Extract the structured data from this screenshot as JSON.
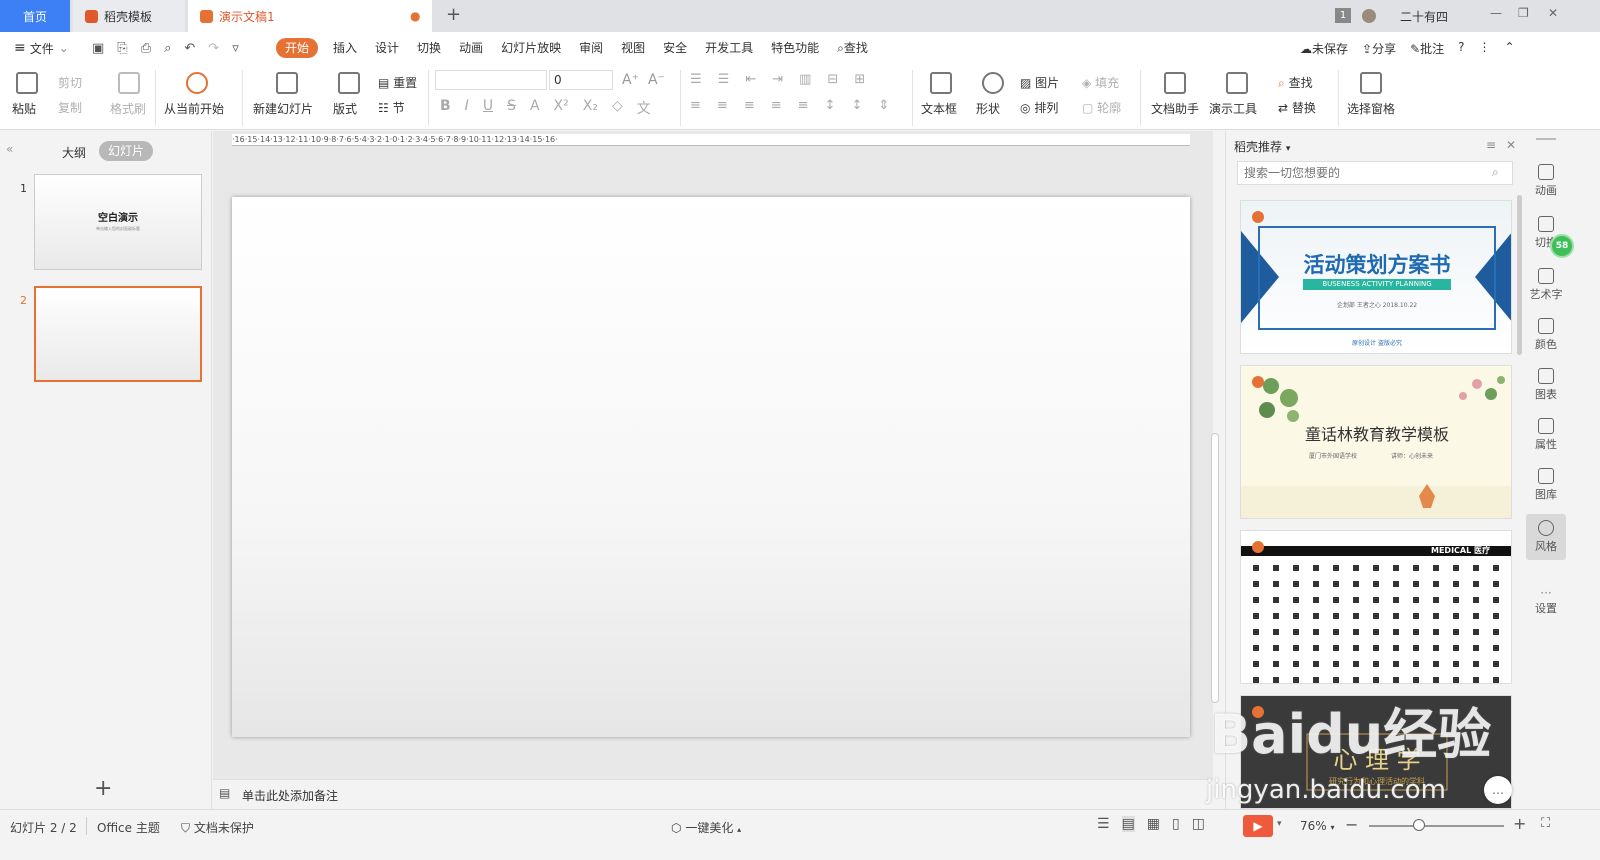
{
  "tabs": {
    "home": "首页",
    "template": "稻壳模板",
    "doc": "演示文稿1",
    "add": "+"
  },
  "titlebar": {
    "page_badge": "1",
    "user": "二十有四",
    "minimize": "—",
    "restore": "❐",
    "close": "✕"
  },
  "menubar": {
    "file": "文件",
    "items": [
      "开始",
      "插入",
      "设计",
      "切换",
      "动画",
      "幻灯片放映",
      "审阅",
      "视图",
      "安全",
      "开发工具",
      "特色功能"
    ],
    "search": "查找",
    "unsaved": "未保存",
    "share": "分享",
    "comment": "批注",
    "help": "?"
  },
  "ribbon": {
    "paste": "粘贴",
    "cut": "剪切",
    "copy": "复制",
    "format_painter": "格式刷",
    "play_from_current": "从当前开始",
    "new_slide": "新建幻灯片",
    "layout": "版式",
    "reset": "重置",
    "section": "节",
    "font_size": "0",
    "textbox": "文本框",
    "shape": "形状",
    "picture": "图片",
    "fill": "填充",
    "arrange": "排列",
    "outline": "轮廓",
    "doc_helper": "文档助手",
    "present_tool": "演示工具",
    "find": "查找",
    "replace": "替换",
    "selection_pane": "选择窗格"
  },
  "leftpane": {
    "outline_tab": "大纲",
    "slides_tab": "幻灯片",
    "slide1_num": "1",
    "slide1_title": "空白演示",
    "slide1_sub": "单击输入您的封面副标题",
    "slide2_num": "2",
    "add": "+"
  },
  "ruler": {
    "text": "·16·15·14·13·12·11·10·9·8·7·6·5·4·3·2·1·0·1·2·3·4·5·6·7·8·9·10·11·12·13·14·15·16·"
  },
  "notes": {
    "placeholder": "单击此处添加备注"
  },
  "rightpane": {
    "title": "稻壳推荐",
    "search_placeholder": "搜索一切您想要的",
    "card1": {
      "title": "活动策划方案书",
      "subtitle": "BUSENESS ACTIVITY PLANNING",
      "meta": "企划部   王者之心   2018.10.22",
      "footer": "原创设计  盗版必究"
    },
    "card2": {
      "title": "童话林教育教学模板",
      "meta1": "厦门市外国语学校",
      "meta2": "讲师：心创未来"
    },
    "card3": {
      "label": "MEDICAL 医疗"
    },
    "card4": {
      "title": "心 理 学",
      "subtitle": "研究行为和心理活动的学科"
    }
  },
  "sidebar": {
    "items": [
      "动画",
      "切换",
      "艺术字",
      "颜色",
      "图表",
      "属性",
      "图库",
      "风格",
      "设置"
    ],
    "badge": "58"
  },
  "statusbar": {
    "slide_counter": "幻灯片 2 / 2",
    "theme": "Office 主题",
    "protect": "文档未保护",
    "beautify": "一键美化",
    "zoom": "76%"
  },
  "watermark": {
    "brand": "Baidu经验",
    "url": "jingyan.baidu.com"
  }
}
